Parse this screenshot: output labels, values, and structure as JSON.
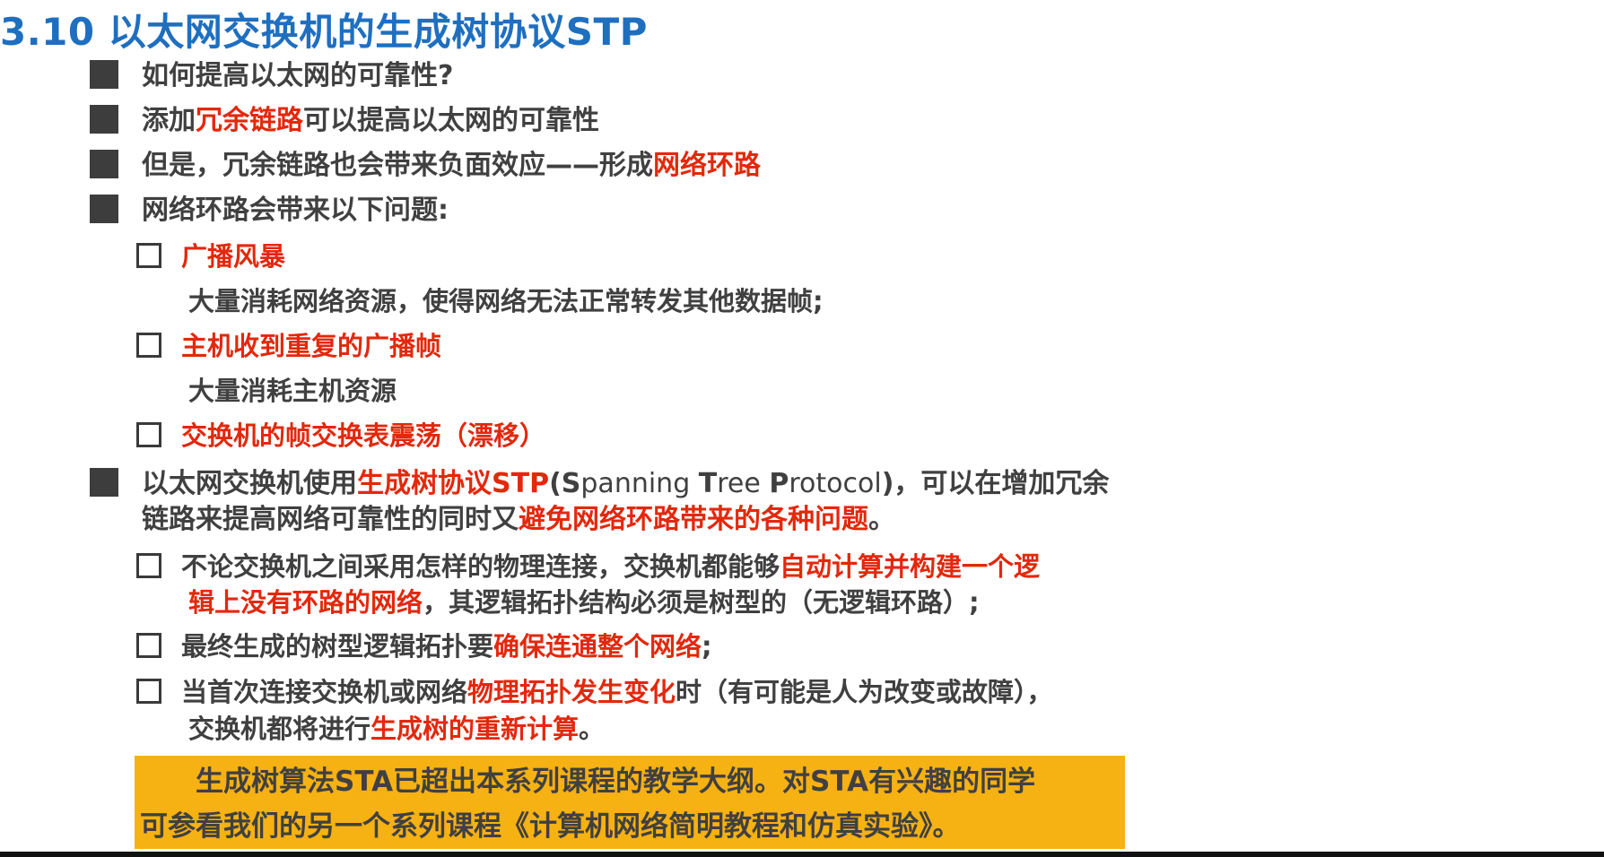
{
  "title": "3.10 以太网交换机的生成树协议STP",
  "bullets": {
    "b1": "如何提高以太网的可靠性?",
    "b2_pre": "添加",
    "b2_red": "冗余链路",
    "b2_post": "可以提高以太网的可靠性",
    "b3_pre": "但是，冗余链路也会带来负面效应——形成",
    "b3_red": "网络环路",
    "b4": "网络环路会带来以下问题:",
    "b5_pre": "以太网交换机使用",
    "b5_red": "生成树协议STP",
    "b5_paren_open": "(",
    "b5_s": "S",
    "b5_spanning": "panning ",
    "b5_t": "T",
    "b5_tree": "ree ",
    "b5_p": "P",
    "b5_protocol": "rotocol",
    "b5_post": ")，可以在增加冗余",
    "b5_line2_pre": "链路来提高网络可靠性的同时又",
    "b5_line2_red": "避免网络环路带来的各种问题",
    "b5_line2_post": "。"
  },
  "problems": {
    "p1_label": "广播风暴",
    "p1_desc": "大量消耗网络资源，使得网络无法正常转发其他数据帧;",
    "p2_label": "主机收到重复的广播帧",
    "p2_desc": "大量消耗主机资源",
    "p3_label": "交换机的帧交换表震荡（漂移）"
  },
  "stp_points": {
    "s1_pre": "不论交换机之间采用怎样的物理连接，交换机都能够",
    "s1_red": "自动计算并构建一个逻",
    "s1_line2_red": "辑上没有环路的网络",
    "s1_line2_post": "，其逻辑拓扑结构必须是树型的（无逻辑环路）;",
    "s2_pre": "最终生成的树型逻辑拓扑要",
    "s2_red": "确保连通整个网络",
    "s2_post": ";",
    "s3_pre": "当首次连接交换机或网络",
    "s3_red": "物理拓扑发生变化",
    "s3_post": "时（有可能是人为改变或故障），",
    "s3_line2_pre": "交换机都将进行",
    "s3_line2_red": "生成树的重新计算",
    "s3_line2_post": "。"
  },
  "note": {
    "line1": "　　生成树算法STA已超出本系列课程的教学大纲。对STA有兴趣的同学",
    "line2": "可参看我们的另一个系列课程《计算机网络简明教程和仿真实验》。"
  },
  "colors": {
    "title": "#1f6fc0",
    "red": "#e3280c",
    "text": "#404040",
    "note_bg": "#f6b113"
  }
}
